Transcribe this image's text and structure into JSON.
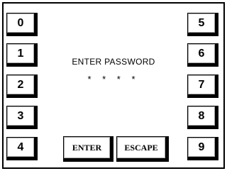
{
  "keypad": {
    "left": [
      "0",
      "1",
      "2",
      "3",
      "4"
    ],
    "right": [
      "5",
      "6",
      "7",
      "8",
      "9"
    ]
  },
  "display": {
    "prompt": "ENTER PASSWORD",
    "masked_input": "* * * *"
  },
  "actions": {
    "enter_label": "ENTER",
    "escape_label": "ESCAPE"
  }
}
